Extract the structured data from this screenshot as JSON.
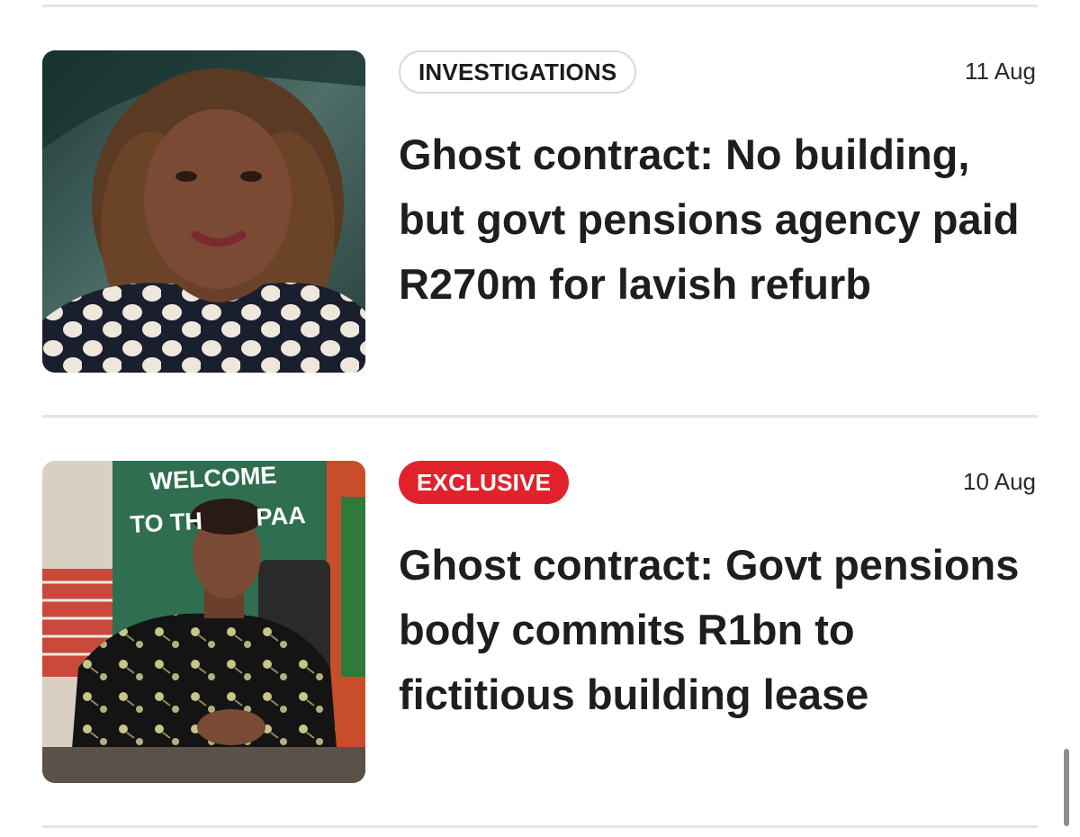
{
  "articles": [
    {
      "category": "INVESTIGATIONS",
      "category_style": "outline",
      "date": "11 Aug",
      "headline": "Ghost contract: No building, but govt pensions agency paid R270m for lavish refurb",
      "image_icon": "portrait-photo"
    },
    {
      "category": "EXCLUSIVE",
      "category_style": "filled",
      "category_color": "#e1222c",
      "date": "10 Aug",
      "headline": "Ghost contract: Govt pensions body commits R1bn to fictitious building lease",
      "image_icon": "office-portrait-photo",
      "image_sign_text": "WELCOME TO TH  PAA"
    }
  ],
  "colors": {
    "accent": "#e1222c",
    "text": "#1e1e1e",
    "divider": "#e4e4e4"
  }
}
